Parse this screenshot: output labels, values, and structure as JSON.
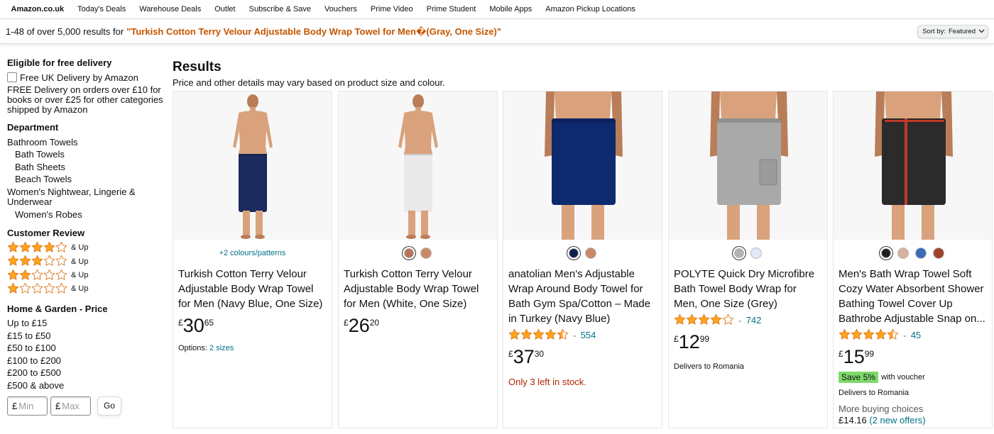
{
  "nav": {
    "brand": "Amazon.co.uk",
    "links": [
      "Today's Deals",
      "Warehouse Deals",
      "Outlet",
      "Subscribe & Save",
      "Vouchers",
      "Prime Video",
      "Prime Student",
      "Mobile Apps",
      "Amazon Pickup Locations"
    ]
  },
  "results_bar": {
    "summary": "1-48 of over 5,000 results for",
    "query": "\"Turkish Cotton Terry Velour Adjustable Body Wrap Towel for Men�(Gray, One Size)\"",
    "sort_label": "Sort by:",
    "sort_value": "Featured"
  },
  "sidebar": {
    "delivery": {
      "heading": "Eligible for free delivery",
      "checkbox_label": "Free UK Delivery by Amazon",
      "note": "FREE Delivery on orders over £10 for books or over £25 for other categories shipped by Amazon"
    },
    "department": {
      "heading": "Department",
      "items": [
        "Bathroom Towels",
        "Bath Towels",
        "Bath Sheets",
        "Beach Towels",
        "Women's Nightwear, Lingerie & Underwear",
        "Women's Robes"
      ]
    },
    "review": {
      "heading": "Customer Review",
      "rows": [
        {
          "stars": 4,
          "label": "& Up"
        },
        {
          "stars": 3,
          "label": "& Up"
        },
        {
          "stars": 2,
          "label": "& Up"
        },
        {
          "stars": 1,
          "label": "& Up"
        }
      ]
    },
    "price": {
      "heading": "Home & Garden - Price",
      "ranges": [
        "Up to £15",
        "£15 to £50",
        "£50 to £100",
        "£100 to £200",
        "£200 to £500",
        "£500 & above"
      ],
      "currency": "£",
      "min_placeholder": "Min",
      "max_placeholder": "Max",
      "go_label": "Go"
    }
  },
  "results": {
    "heading": "Results",
    "subheading": "Price and other details may vary based on product size and colour."
  },
  "products": [
    {
      "towel_color": "#1b2a5c",
      "colours_link": "+2 colours/patterns",
      "title": "Turkish Cotton Terry Velour Adjustable Body Wrap Towel for Men (Navy Blue, One Size)",
      "price_currency": "£",
      "price_whole": "30",
      "price_fraction": "65",
      "options_label": "Options:",
      "options_link": "2 sizes"
    },
    {
      "towel_color": "#e9e9e9",
      "swatches": [
        "#b9745a",
        "#c98a6b"
      ],
      "title": "Turkish Cotton Terry Velour Adjustable Body Wrap Towel for Men (White, One Size)",
      "price_currency": "£",
      "price_whole": "26",
      "price_fraction": "20"
    },
    {
      "towel_color": "#0d2a6e",
      "swatches": [
        "#0e1f4d",
        "#c98a6b"
      ],
      "title": "anatolian Men's Adjustable Wrap Around Body Towel for Bath Gym Spa/Cotton – Made in Turkey (Navy Blue)",
      "rating": 4.5,
      "reviews": "554",
      "price_currency": "£",
      "price_whole": "37",
      "price_fraction": "30",
      "stock": "Only 3 left in stock."
    },
    {
      "towel_color": "#a9a9aa",
      "swatches": [
        "#b3b3b3",
        "#dfe9f7"
      ],
      "title": "POLYTE Quick Dry Microfibre Bath Towel Body Wrap for Men, One Size (Grey)",
      "rating": 4,
      "reviews": "742",
      "price_currency": "£",
      "price_whole": "12",
      "price_fraction": "99",
      "delivery": "Delivers to Romania"
    },
    {
      "towel_color": "#2b2b2b",
      "swatches": [
        "#1f1f1f",
        "#d3b2a0",
        "#3a6bb5",
        "#a0432e"
      ],
      "title": "Men's Bath Wrap Towel Soft Cozy Water Absorbent Shower Bathing Towel Cover Up Bathrobe Adjustable Snap on...",
      "rating": 4.5,
      "reviews": "45",
      "price_currency": "£",
      "price_whole": "15",
      "price_fraction": "99",
      "save_badge": "Save 5%",
      "voucher_text": "with voucher",
      "delivery": "Delivers to Romania",
      "more_choices": "More buying choices",
      "more_price": "£14.16",
      "more_offers": "(2 new offers)"
    }
  ]
}
